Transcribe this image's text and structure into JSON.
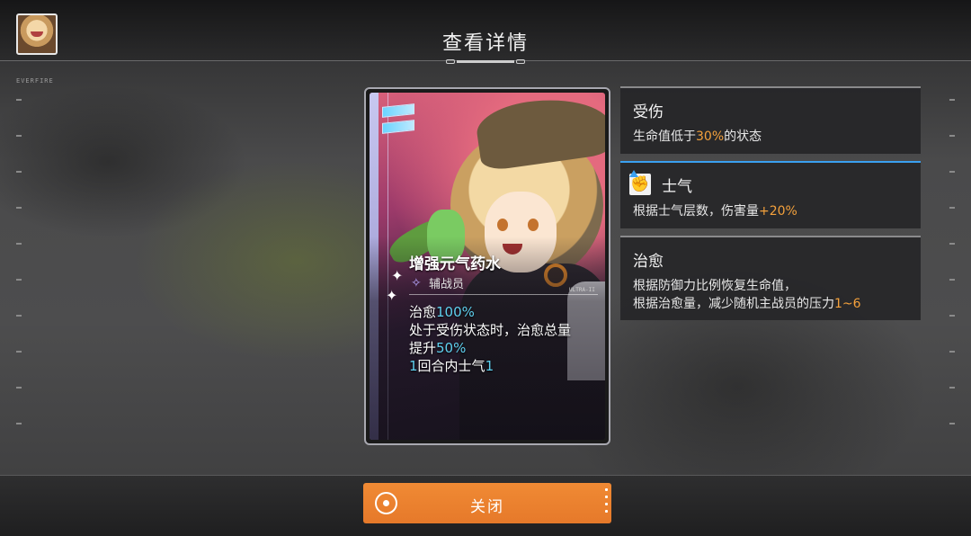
{
  "header": {
    "title": "查看详情",
    "small_label": "EVERFIRE"
  },
  "card": {
    "name": "增强元气药水",
    "role": "辅战员",
    "role_icon": "sparkle-star-icon",
    "code": "ULTRA-II",
    "desc": {
      "line1_prefix": "治愈",
      "line1_value": "100%",
      "line2": "处于受伤状态时，治愈总量",
      "line3_prefix": "提升",
      "line3_value": "50%",
      "line4_value_a": "1",
      "line4_mid": "回合内士气",
      "line4_value_b": "1"
    }
  },
  "panels": [
    {
      "title": "受伤",
      "body_prefix": "生命值低于",
      "body_value": "30%",
      "body_suffix": "的状态"
    },
    {
      "title": "士气",
      "icon": "fist-icon",
      "body_prefix": "根据士气层数，伤害量",
      "body_value": "+20%",
      "body_suffix": ""
    },
    {
      "title": "治愈",
      "body_line1": "根据防御力比例恢复生命值，",
      "body_line2_prefix": "根据治愈量，减少随机主战员的压力",
      "body_line2_value": "1~6"
    }
  ],
  "footer": {
    "close_label": "关闭"
  },
  "colors": {
    "accent_orange": "#f08a34",
    "highlight_cyan": "#5fd0ef",
    "highlight_orange": "#f4a13c"
  }
}
